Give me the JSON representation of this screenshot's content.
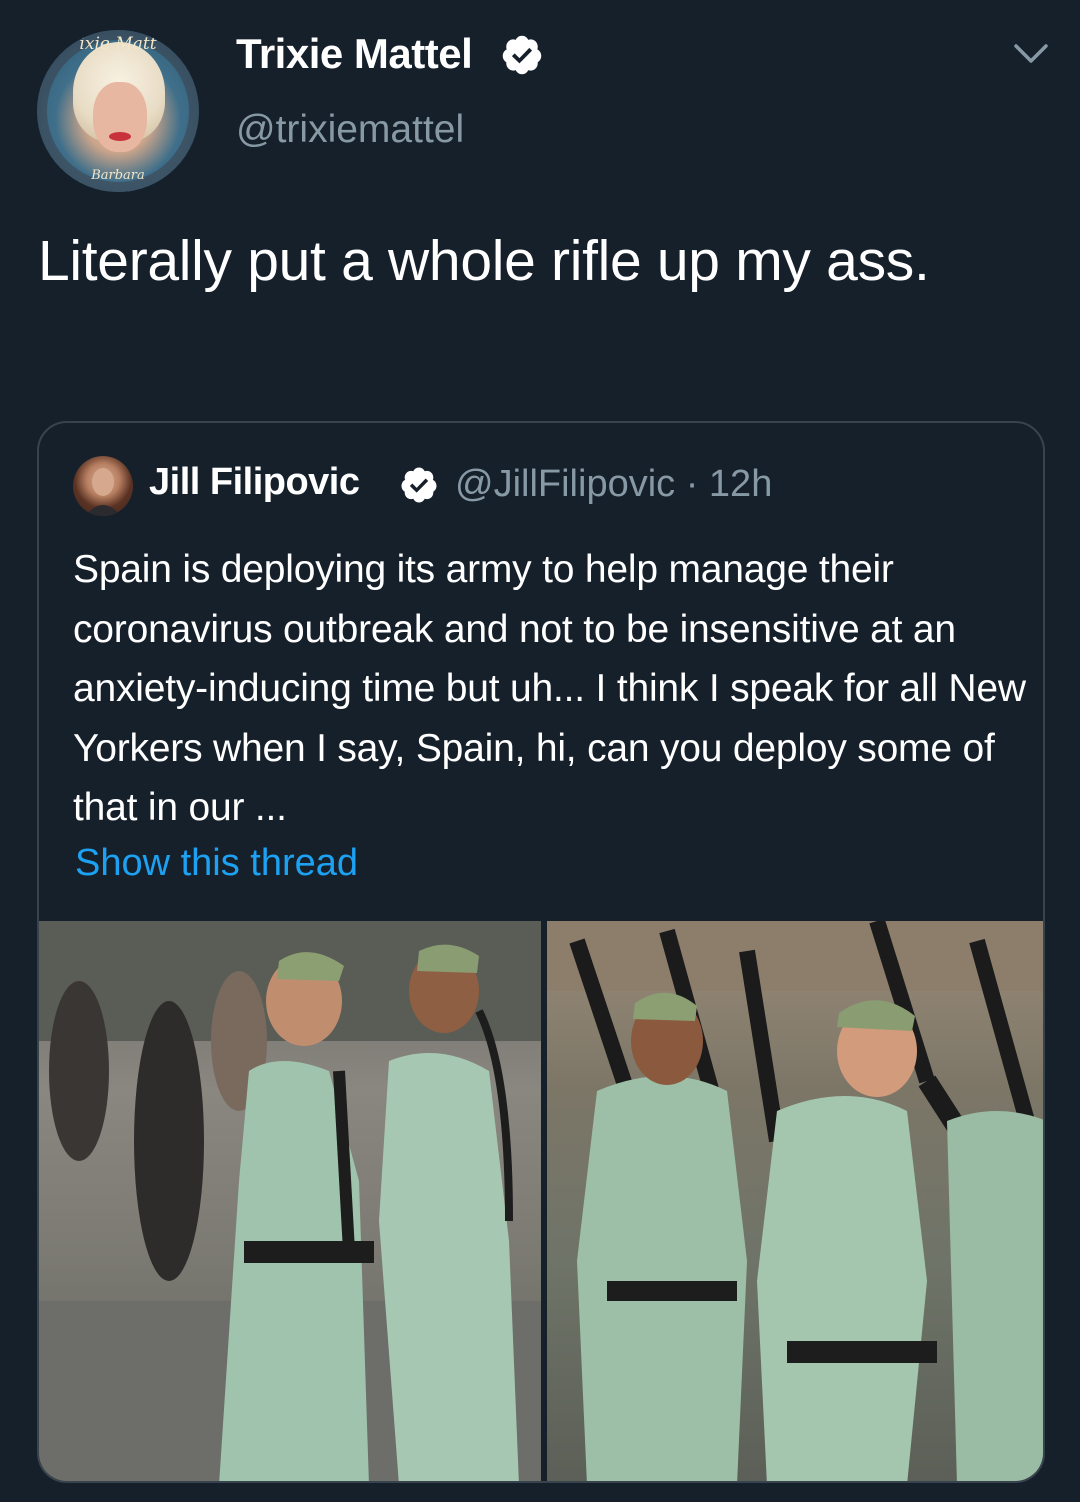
{
  "author": {
    "display_name": "Trixie Mattel",
    "handle": "@trixiemattel",
    "avatar_text_top": "ixie Matt",
    "avatar_text_bottom": "Barbara",
    "verified_icon": "verified-badge-icon"
  },
  "tweet": {
    "text": "Literally put a whole rifle up my ass."
  },
  "menu_icon": "chevron-down-icon",
  "quoted_tweet": {
    "display_name": "Jill Filipovic",
    "handle_time": "@JillFilipovic · 12h",
    "text": "Spain is deploying its army to help manage their coronavirus outbreak and not to be insensitive at an anxiety-inducing time but uh... I think I speak for all New Yorkers when I say, Spain, hi, can you deploy some of that in our ...",
    "show_thread": "Show this thread",
    "verified_icon": "verified-badge-icon"
  },
  "colors": {
    "background": "#15202b",
    "secondary_text": "#8899a6",
    "link": "#1da1f2",
    "border": "#38444d",
    "verified": "#1da1f2"
  }
}
